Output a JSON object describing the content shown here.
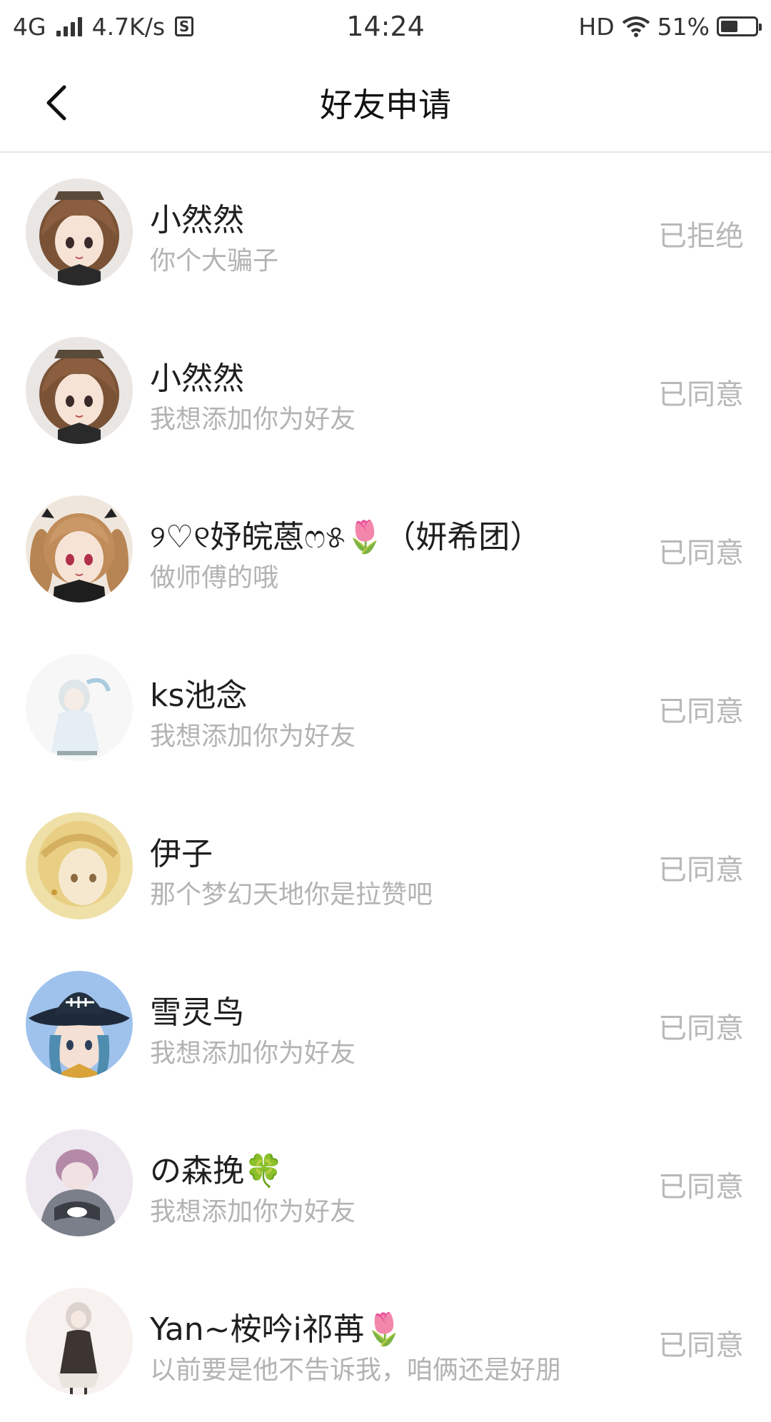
{
  "status_bar": {
    "network": "4G",
    "speed": "4.7K/s",
    "time": "14:24",
    "hd": "HD",
    "battery": "51%",
    "battery_level": 0.51
  },
  "header": {
    "title": "好友申请"
  },
  "requests": [
    {
      "name": "小然然",
      "message": "你个大骗子",
      "status": "已拒绝",
      "avatar": "anime-girl-brown-hair-avatar"
    },
    {
      "name": "小然然",
      "message": "我想添加你为好友",
      "status": "已同意",
      "avatar": "anime-girl-brown-hair-avatar"
    },
    {
      "name": "୨♡୧妤皖蒽ෆ୫🌷（妍希团）",
      "message": "做师傅的哦",
      "status": "已同意",
      "avatar": "anime-girl-twintails-avatar"
    },
    {
      "name": "ks池念",
      "message": "我想添加你为好友",
      "status": "已同意",
      "avatar": "anime-white-outfit-avatar"
    },
    {
      "name": "伊子",
      "message": "那个梦幻天地你是拉赞吧",
      "status": "已同意",
      "avatar": "anime-blonde-braid-avatar"
    },
    {
      "name": "雪灵鸟",
      "message": "我想添加你为好友",
      "status": "已同意",
      "avatar": "anime-pirate-hat-avatar"
    },
    {
      "name": "の森挽🍀",
      "message": "我想添加你为好友",
      "status": "已同意",
      "avatar": "anime-hooded-boy-avatar"
    },
    {
      "name": "Yan~桉吟ⅰ祁苒🌷",
      "message": "以前要是他不告诉我，咱俩还是好朋",
      "status": "已同意",
      "avatar": "anime-girl-dress-avatar"
    }
  ]
}
